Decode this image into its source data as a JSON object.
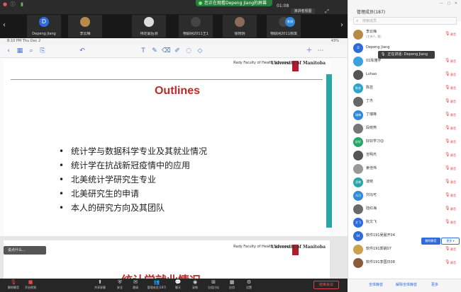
{
  "colors": {
    "accent": "#2f6bd9",
    "slide_title": "#c0282a",
    "muted": "#e34848",
    "share_banner": "#2a7d3a"
  },
  "titlebar": {
    "share_banner": "您正在观看Depeng Jiang的屏幕",
    "clock": "01:08",
    "speaker_view": "演讲者视图",
    "icons": [
      "close-icon",
      "info-icon",
      "signal-icon",
      "fullscreen-icon"
    ]
  },
  "video_tiles": [
    {
      "initial": "D",
      "name": "Depeng Jiang",
      "color": "#2f6bd9"
    },
    {
      "initial": "",
      "name": "李云梅",
      "color": "#b88a4a"
    },
    {
      "initial": "",
      "name": "待定最后测",
      "color": "#ddd"
    },
    {
      "initial": "",
      "name": "物联网2011王1",
      "color": "#444"
    },
    {
      "initial": "",
      "name": "徐晓玥",
      "color": "#8a6a58"
    },
    {
      "initial": "",
      "name": "物联网2011陈琪",
      "color": "#444"
    },
    {
      "initial": "陈琪",
      "name": "",
      "color": "#2f8ad9"
    }
  ],
  "ipad": {
    "status_time": "8:10 PM  Thu Dec 2",
    "battery": "43%",
    "toolbar_icons": [
      "back-icon",
      "grid-icon",
      "search-icon",
      "bookmark-icon",
      "undo-icon",
      "text-icon",
      "pen-icon",
      "eraser-icon",
      "highlighter-icon",
      "lasso-icon",
      "shape-icon",
      "image-icon",
      "add-icon",
      "more-icon"
    ]
  },
  "slide": {
    "logo_left": "Rady Faculty of Health Sciences",
    "logo_right": "University of Manitoba",
    "title": "Outlines",
    "bullets": [
      "统计学与数据科学专业及其就业情况",
      "统计学在抗战新冠疫情中的应用",
      "北美统计学研究生专业",
      "北美研究生的申请",
      "本人的研究方向及其团队"
    ],
    "next_title": "统计学就业情况",
    "hint": "说点什么..."
  },
  "bottombar": [
    {
      "icon": "mic-icon",
      "label": "解除静音"
    },
    {
      "icon": "camera-icon",
      "label": "开启视频"
    },
    {
      "icon": "share-screen-icon",
      "label": "共享屏幕"
    },
    {
      "icon": "security-icon",
      "label": "安全"
    },
    {
      "icon": "invite-icon",
      "label": "邀请"
    },
    {
      "icon": "participants-icon",
      "label": "管理成员(187)"
    },
    {
      "icon": "chat-icon",
      "label": "聊天"
    },
    {
      "icon": "record-icon",
      "label": "录制"
    },
    {
      "icon": "breakout-icon",
      "label": "分组讨论"
    },
    {
      "icon": "apps-icon",
      "label": "应用"
    },
    {
      "icon": "settings-icon",
      "label": "设置"
    }
  ],
  "end_meeting": "结束会议",
  "panel": {
    "title": "管理成员(187)",
    "search_placeholder": "搜索成员",
    "talk_tip": "正在讲话: Depeng Jiang",
    "mute_label": "静音",
    "unmute_btn": "解除静音",
    "more_btn": "更多 ▾",
    "members": [
      {
        "name": "李云梅",
        "sub": "(主持人, 我)",
        "avatar": "",
        "color": "#b88a4a",
        "muted": true
      },
      {
        "name": "Depeng Jiang",
        "sub": "",
        "avatar": "D",
        "color": "#2f6bd9",
        "muted": false
      },
      {
        "name": "01陈雅宇",
        "sub": "",
        "avatar": "",
        "color": "#3aa0e0",
        "muted": true
      },
      {
        "name": "Lvhao",
        "sub": "",
        "avatar": "",
        "color": "#555",
        "muted": true
      },
      {
        "name": "陈芸",
        "sub": "",
        "avatar": "陈芸",
        "color": "#2aa6c9",
        "muted": true
      },
      {
        "name": "丁杰",
        "sub": "",
        "avatar": "",
        "color": "#666",
        "muted": true
      },
      {
        "name": "丁瑞锋",
        "sub": "",
        "avatar": "瑞锋",
        "color": "#2f8ad9",
        "muted": true
      },
      {
        "name": "段晓燕",
        "sub": "",
        "avatar": "",
        "color": "#777",
        "muted": true
      },
      {
        "name": "好好学习😊",
        "sub": "",
        "avatar": "好好",
        "color": "#2aa66a",
        "muted": true
      },
      {
        "name": "吉明杰",
        "sub": "",
        "avatar": "",
        "color": "#555",
        "muted": true
      },
      {
        "name": "姜佳伟",
        "sub": "",
        "avatar": "",
        "color": "#999",
        "muted": true
      },
      {
        "name": "凌晓",
        "sub": "",
        "avatar": "凌晓",
        "color": "#2aa6a6",
        "muted": true
      },
      {
        "name": "刘马可",
        "sub": "",
        "avatar": "马可",
        "color": "#2f8ad9",
        "muted": true
      },
      {
        "name": "陆红海",
        "sub": "",
        "avatar": "",
        "color": "#6a6a6a",
        "muted": true
      },
      {
        "name": "阮文飞",
        "sub": "",
        "avatar": "文飞",
        "color": "#2f6bd9",
        "muted": true
      },
      {
        "name": "软件191吴晨开04",
        "sub": "",
        "avatar": "04",
        "color": "#2f6bd9",
        "muted": false
      },
      {
        "name": "软件191郭娟07",
        "sub": "",
        "avatar": "",
        "color": "#c9a24a",
        "muted": true
      },
      {
        "name": "软件191李国日08",
        "sub": "",
        "avatar": "",
        "color": "#8a5a3a",
        "muted": true
      }
    ]
  },
  "panel_footer": {
    "mute_all": "全体静音",
    "unmute_all": "解除全体静音",
    "more": "更多"
  }
}
